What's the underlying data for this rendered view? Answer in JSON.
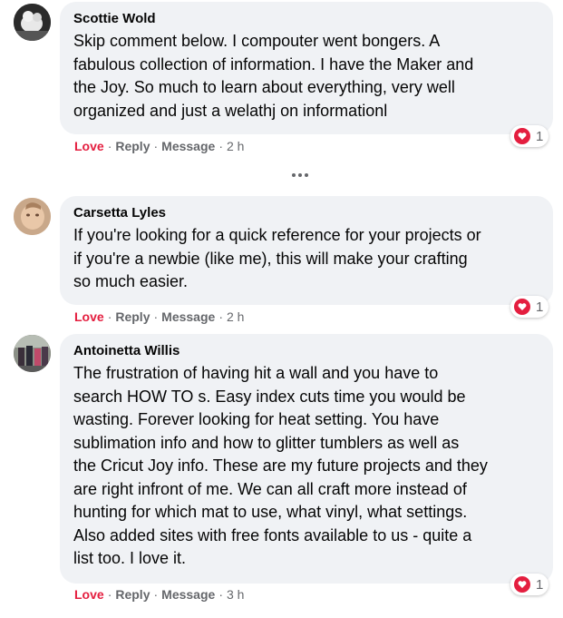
{
  "comments": [
    {
      "author": "Scottie Wold",
      "text": "Skip comment below. I compouter went bongers. A\nfabulous collection of information. I have the Maker and\nthe Joy. So much to learn about everything, very well\norganized and just a welathj on informationl",
      "reaction_count": "1",
      "actions": {
        "love": "Love",
        "reply": "Reply",
        "message": "Message",
        "sep": "·",
        "time": "2 h"
      }
    },
    {
      "author": "Carsetta Lyles",
      "text": "If you're looking for a quick reference for your projects or\nif you're a newbie (like me), this will make your crafting\nso much easier.",
      "reaction_count": "1",
      "actions": {
        "love": "Love",
        "reply": "Reply",
        "message": "Message",
        "sep": "·",
        "time": "2 h"
      }
    },
    {
      "author": "Antoinetta Willis",
      "text": "The frustration of having hit a wall and you have to\nsearch HOW TO s. Easy index cuts time you would be\nwasting. Forever looking for heat setting. You have\nsublimation info and how to glitter tumblers as well as\nthe Cricut Joy info. These are my future projects and they\nare right infront of me. We can all craft more instead of\nhunting for which mat to use, what vinyl, what settings.\nAlso added sites with free fonts available to us - quite a\nlist too. I love it.",
      "reaction_count": "1",
      "actions": {
        "love": "Love",
        "reply": "Reply",
        "message": "Message",
        "sep": "·",
        "time": "3 h"
      }
    }
  ],
  "more_icon": "more-horizontal-icon",
  "reaction_icon": "heart-icon",
  "colors": {
    "bubble": "#f0f2f5",
    "love": "#e41e3f",
    "meta": "#65676b",
    "text": "#050505"
  }
}
